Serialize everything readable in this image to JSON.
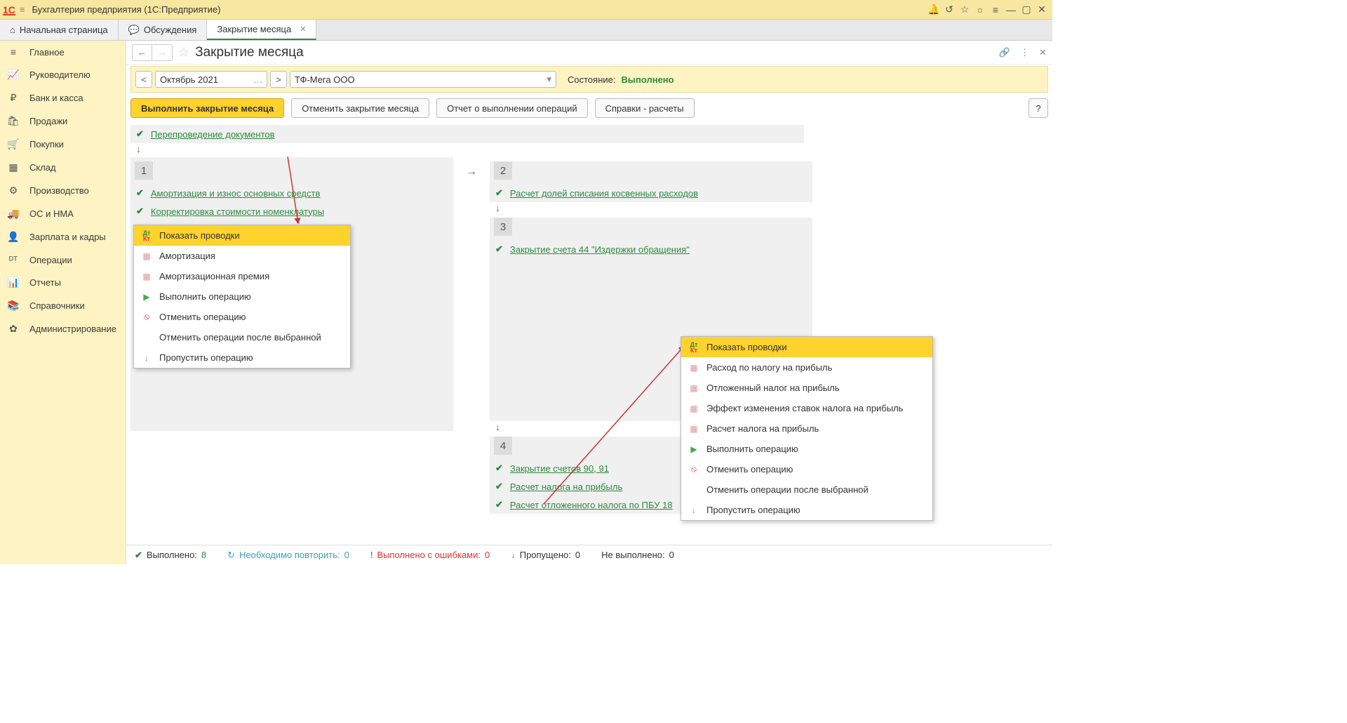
{
  "titlebar": {
    "app": "Бухгалтерия предприятия  (1С:Предприятие)"
  },
  "tabs": {
    "home": "Начальная страница",
    "discuss": "Обсуждения",
    "month_close": "Закрытие месяца"
  },
  "sidebar": {
    "items": [
      {
        "icon": "≡",
        "label": "Главное"
      },
      {
        "icon": "📈",
        "label": "Руководителю"
      },
      {
        "icon": "₽",
        "label": "Банк и касса"
      },
      {
        "icon": "🛍",
        "label": "Продажи"
      },
      {
        "icon": "🛒",
        "label": "Покупки"
      },
      {
        "icon": "▦",
        "label": "Склад"
      },
      {
        "icon": "⚙",
        "label": "Производство"
      },
      {
        "icon": "🚚",
        "label": "ОС и НМА"
      },
      {
        "icon": "👤",
        "label": "Зарплата и кадры"
      },
      {
        "icon": "ᴰᵀ",
        "label": "Операции"
      },
      {
        "icon": "📊",
        "label": "Отчеты"
      },
      {
        "icon": "📚",
        "label": "Справочники"
      },
      {
        "icon": "✿",
        "label": "Администрирование"
      }
    ]
  },
  "page": {
    "title": "Закрытие месяца",
    "period": "Октябрь 2021",
    "org": "ТФ-Мега ООО",
    "state_label": "Состояние:",
    "state_value": "Выполнено"
  },
  "actions": {
    "execute": "Выполнить закрытие месяца",
    "cancel": "Отменить закрытие месяца",
    "report": "Отчет о выполнении операций",
    "refs": "Справки - расчеты"
  },
  "ops": {
    "repost": "Перепроведение документов",
    "b1": {
      "num": "1",
      "amort": "Амортизация и износ основных средств",
      "corr": "Корректировка стоимости номенклатуры"
    },
    "b2": {
      "num": "2",
      "alloc": "Расчет долей списания косвенных расходов"
    },
    "b3": {
      "num": "3",
      "close44": "Закрытие счета 44 \"Издержки обращения\""
    },
    "b4": {
      "num": "4",
      "close9091": "Закрытие счетов 90, 91",
      "taxcalc": "Расчет налога на прибыль",
      "defer": "Расчет отложенного налога по ПБУ 18"
    }
  },
  "ctx1": {
    "show": "Показать проводки",
    "amort": "Амортизация",
    "bonus": "Амортизационная премия",
    "exec": "Выполнить операцию",
    "cancel": "Отменить операцию",
    "cancel_after": "Отменить операции после выбранной",
    "skip": "Пропустить операцию"
  },
  "ctx2": {
    "show": "Показать проводки",
    "taxexp": "Расход по налогу на прибыль",
    "defer": "Отложенный налог на прибыль",
    "effect": "Эффект изменения ставок налога на прибыль",
    "taxcalc": "Расчет налога на прибыль",
    "exec": "Выполнить операцию",
    "cancel": "Отменить операцию",
    "cancel_after": "Отменить операции после выбранной",
    "skip": "Пропустить операцию"
  },
  "status": {
    "done_label": "Выполнено:",
    "done_n": "8",
    "redo_label": "Необходимо повторить:",
    "redo_n": "0",
    "err_label": "Выполнено с ошибками:",
    "err_n": "0",
    "skip_label": "Пропущено:",
    "skip_n": "0",
    "nd_label": "Не выполнено:",
    "nd_n": "0"
  }
}
